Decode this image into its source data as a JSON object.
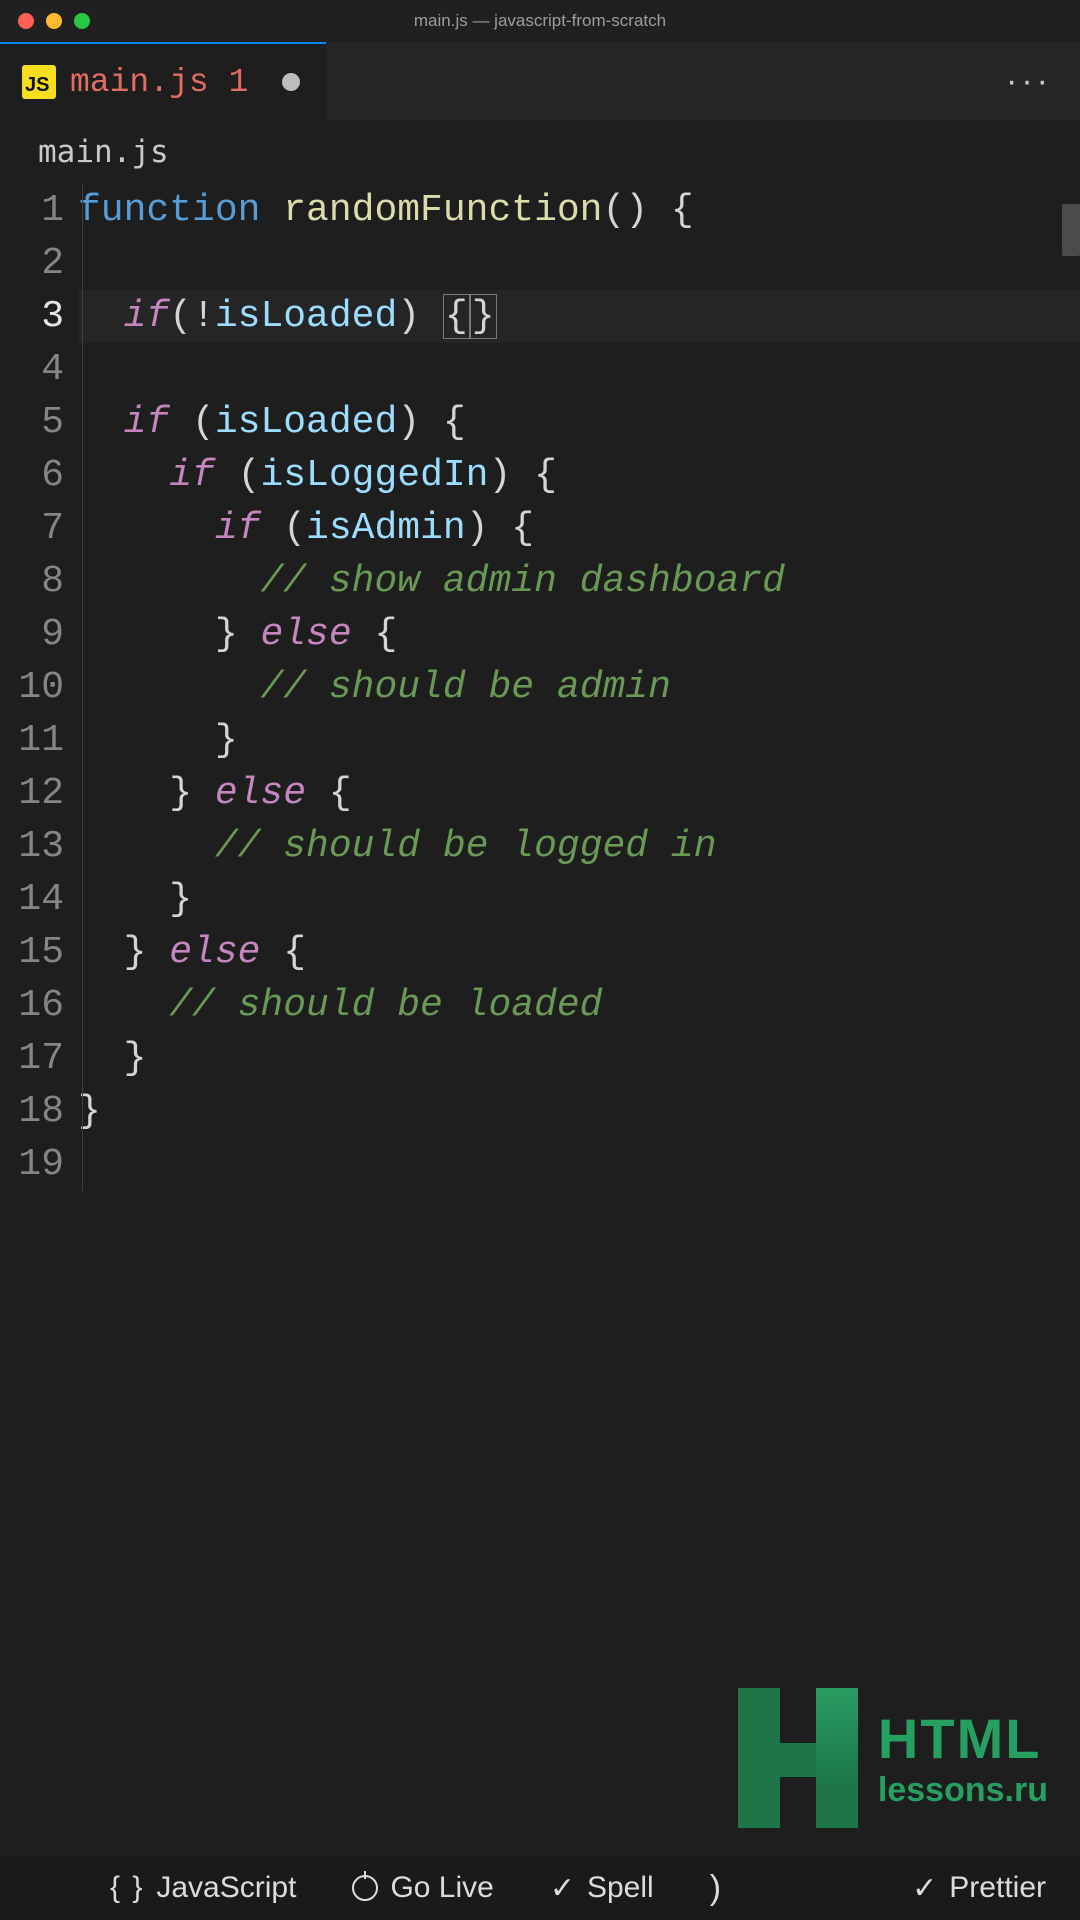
{
  "window": {
    "title": "main.js — javascript-from-scratch"
  },
  "tab": {
    "filename": "main.js",
    "problem_count": "1"
  },
  "breadcrumb": {
    "path": "main.js"
  },
  "editor": {
    "active_line": 3,
    "lines": [
      {
        "n": 1,
        "tokens": [
          {
            "t": "function ",
            "c": "kw"
          },
          {
            "t": "randomFunction",
            "c": "fn"
          },
          {
            "t": "()",
            "c": "p"
          },
          {
            "t": " {",
            "c": "p"
          }
        ]
      },
      {
        "n": 2,
        "tokens": [
          {
            "t": "",
            "c": "p"
          }
        ]
      },
      {
        "n": 3,
        "tokens": [
          {
            "t": "  ",
            "c": "p"
          },
          {
            "t": "if",
            "c": "k"
          },
          {
            "t": "(",
            "c": "p"
          },
          {
            "t": "!",
            "c": "op"
          },
          {
            "t": "isLoaded",
            "c": "id"
          },
          {
            "t": ") ",
            "c": "p"
          },
          {
            "t": "{",
            "c": "p br-hi"
          },
          {
            "t": "}",
            "c": "p br-hi"
          }
        ]
      },
      {
        "n": 4,
        "tokens": [
          {
            "t": "",
            "c": "p"
          }
        ]
      },
      {
        "n": 5,
        "tokens": [
          {
            "t": "  ",
            "c": "p"
          },
          {
            "t": "if",
            "c": "k"
          },
          {
            "t": " (",
            "c": "p"
          },
          {
            "t": "isLoaded",
            "c": "id"
          },
          {
            "t": ") {",
            "c": "p"
          }
        ]
      },
      {
        "n": 6,
        "tokens": [
          {
            "t": "    ",
            "c": "p"
          },
          {
            "t": "if",
            "c": "k"
          },
          {
            "t": " (",
            "c": "p"
          },
          {
            "t": "isLoggedIn",
            "c": "id"
          },
          {
            "t": ") {",
            "c": "p"
          }
        ]
      },
      {
        "n": 7,
        "tokens": [
          {
            "t": "      ",
            "c": "p"
          },
          {
            "t": "if",
            "c": "k"
          },
          {
            "t": " (",
            "c": "p"
          },
          {
            "t": "isAdmin",
            "c": "id"
          },
          {
            "t": ") {",
            "c": "p"
          }
        ]
      },
      {
        "n": 8,
        "tokens": [
          {
            "t": "        ",
            "c": "p"
          },
          {
            "t": "// show admin dashboard",
            "c": "cm"
          }
        ]
      },
      {
        "n": 9,
        "tokens": [
          {
            "t": "      } ",
            "c": "p"
          },
          {
            "t": "else",
            "c": "k"
          },
          {
            "t": " {",
            "c": "p"
          }
        ]
      },
      {
        "n": 10,
        "tokens": [
          {
            "t": "        ",
            "c": "p"
          },
          {
            "t": "// should be admin",
            "c": "cm"
          }
        ]
      },
      {
        "n": 11,
        "tokens": [
          {
            "t": "      }",
            "c": "p"
          }
        ]
      },
      {
        "n": 12,
        "tokens": [
          {
            "t": "    } ",
            "c": "p"
          },
          {
            "t": "else",
            "c": "k"
          },
          {
            "t": " {",
            "c": "p"
          }
        ]
      },
      {
        "n": 13,
        "tokens": [
          {
            "t": "      ",
            "c": "p"
          },
          {
            "t": "// should be logged in",
            "c": "cm"
          }
        ]
      },
      {
        "n": 14,
        "tokens": [
          {
            "t": "    }",
            "c": "p"
          }
        ]
      },
      {
        "n": 15,
        "tokens": [
          {
            "t": "  } ",
            "c": "p"
          },
          {
            "t": "else",
            "c": "k"
          },
          {
            "t": " {",
            "c": "p"
          }
        ]
      },
      {
        "n": 16,
        "tokens": [
          {
            "t": "    ",
            "c": "p"
          },
          {
            "t": "// should be loaded",
            "c": "cm"
          }
        ]
      },
      {
        "n": 17,
        "tokens": [
          {
            "t": "  }",
            "c": "p"
          }
        ]
      },
      {
        "n": 18,
        "tokens": [
          {
            "t": "}",
            "c": "p"
          }
        ]
      },
      {
        "n": 19,
        "tokens": [
          {
            "t": "",
            "c": "p"
          }
        ]
      }
    ]
  },
  "watermark": {
    "line1": "HTML",
    "line2": "lessons.ru"
  },
  "status": {
    "language": "JavaScript",
    "golive": "Go Live",
    "spell": "Spell",
    "prettier": "Prettier"
  }
}
